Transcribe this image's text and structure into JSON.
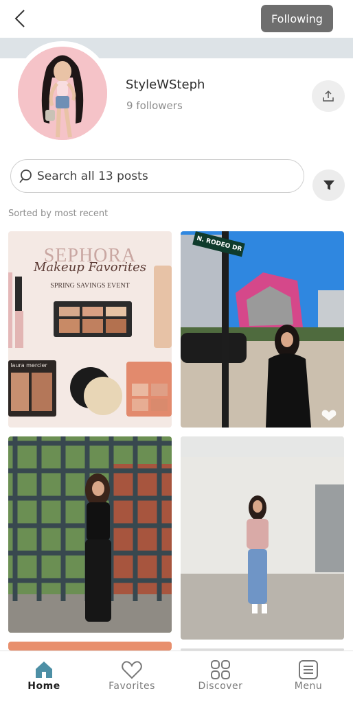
{
  "header": {
    "back_icon": "chevron-left-icon",
    "following_label": "Following"
  },
  "profile": {
    "username": "StyleWSteph",
    "followers": "9 followers",
    "share_icon": "share-icon"
  },
  "search": {
    "placeholder": "Search all 13 posts",
    "filter_icon": "filter-icon"
  },
  "sort_label": "Sorted by most recent",
  "posts": [
    {
      "brand": "SEPHORA",
      "script": "Makeup Favorites",
      "event": "SPRING SAVINGS EVENT",
      "product_text": "laura mercier"
    },
    {
      "street_sign": "N. RODEO DR",
      "liked_icon": "heart-icon"
    },
    {},
    {}
  ],
  "tabs": [
    {
      "label": "Home",
      "icon": "home-icon",
      "active": true
    },
    {
      "label": "Favorites",
      "icon": "heart-outline-icon",
      "active": false
    },
    {
      "label": "Discover",
      "icon": "grid-icon",
      "active": false
    },
    {
      "label": "Menu",
      "icon": "menu-list-icon",
      "active": false
    }
  ],
  "colors": {
    "accent": "#4d8fa5",
    "following_bg": "#6e6e6e",
    "banner": "#dde3e7",
    "avatar_bg": "#f5c3c8"
  }
}
